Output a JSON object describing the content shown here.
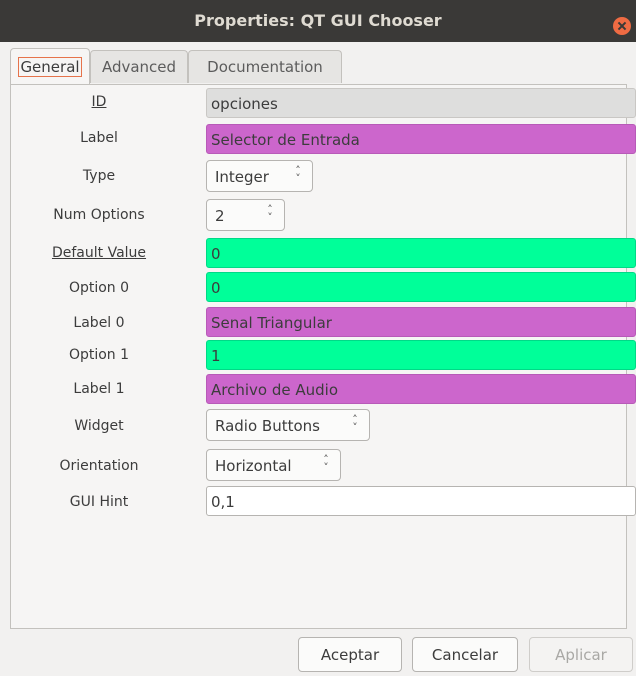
{
  "window": {
    "title": "Properties: QT GUI Chooser"
  },
  "tabs": [
    {
      "label": "General"
    },
    {
      "label": "Advanced"
    },
    {
      "label": "Documentation"
    }
  ],
  "fields": {
    "id": {
      "label": "ID",
      "value": "opciones"
    },
    "label": {
      "label": "Label",
      "value": "Selector de Entrada"
    },
    "type": {
      "label": "Type",
      "value": "Integer"
    },
    "num_options": {
      "label": "Num Options",
      "value": "2"
    },
    "default_value": {
      "label": "Default Value",
      "value": "0"
    },
    "option0": {
      "label": "Option 0",
      "value": "0"
    },
    "label0": {
      "label": "Label 0",
      "value": "Senal Triangular"
    },
    "option1": {
      "label": "Option 1",
      "value": "1"
    },
    "label1": {
      "label": "Label 1",
      "value": "Archivo de Audio"
    },
    "widget": {
      "label": "Widget",
      "value": "Radio Buttons"
    },
    "orientation": {
      "label": "Orientation",
      "value": "Horizontal"
    },
    "gui_hint": {
      "label": "GUI Hint",
      "value": "0,1"
    }
  },
  "buttons": {
    "accept": "Aceptar",
    "cancel": "Cancelar",
    "apply": "Aplicar"
  },
  "icons": {
    "close": "close-icon",
    "spinner": "up-down-chevron-icon"
  },
  "colors": {
    "string_field": "#cc66cc",
    "int_field": "#00ff99",
    "id_field": "#dededd",
    "close_button": "#ef6b43"
  }
}
